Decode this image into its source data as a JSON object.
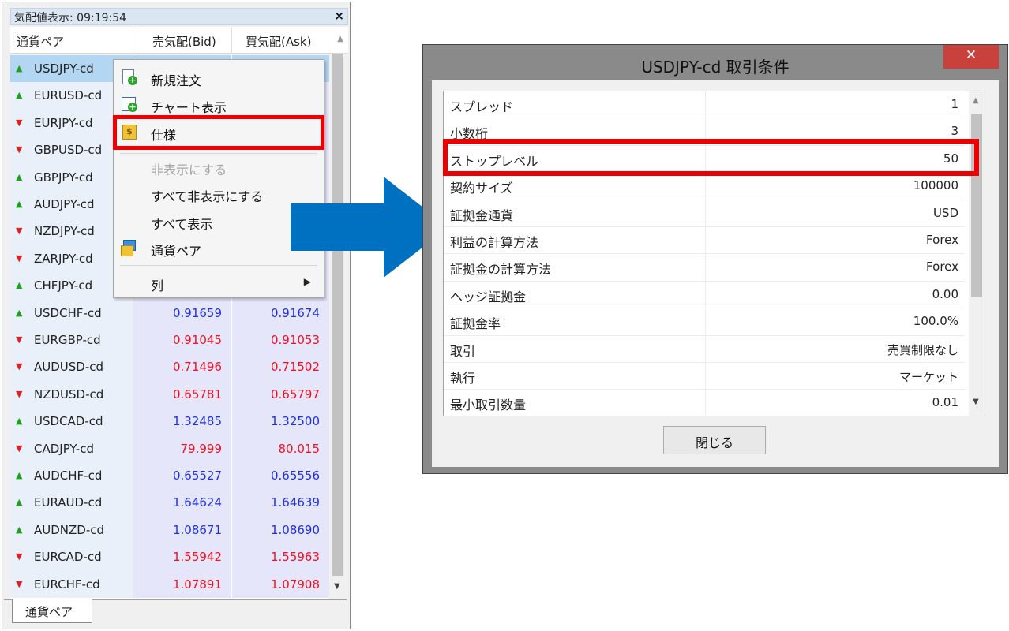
{
  "market_watch": {
    "title": "気配値表示: 09:19:54",
    "close_glyph": "×",
    "columns": {
      "symbol": "通貨ペア",
      "bid": "売気配(Bid)",
      "ask": "買気配(Ask)"
    },
    "rows": [
      {
        "symbol": "USDJPY-cd",
        "dir": "up",
        "bid": "",
        "ask": "",
        "color": "",
        "selected": true
      },
      {
        "symbol": "EURUSD-cd",
        "dir": "up",
        "bid": "",
        "ask": "",
        "color": ""
      },
      {
        "symbol": "EURJPY-cd",
        "dir": "down",
        "bid": "",
        "ask": "",
        "color": ""
      },
      {
        "symbol": "GBPUSD-cd",
        "dir": "down",
        "bid": "",
        "ask": "",
        "color": ""
      },
      {
        "symbol": "GBPJPY-cd",
        "dir": "up",
        "bid": "",
        "ask": "",
        "color": ""
      },
      {
        "symbol": "AUDJPY-cd",
        "dir": "up",
        "bid": "",
        "ask": "",
        "color": ""
      },
      {
        "symbol": "NZDJPY-cd",
        "dir": "down",
        "bid": "",
        "ask": "",
        "color": ""
      },
      {
        "symbol": "ZARJPY-cd",
        "dir": "down",
        "bid": "",
        "ask": "",
        "color": ""
      },
      {
        "symbol": "CHFJPY-cd",
        "dir": "up",
        "bid": "",
        "ask": "",
        "color": ""
      },
      {
        "symbol": "USDCHF-cd",
        "dir": "up",
        "bid": "0.91659",
        "ask": "0.91674",
        "color": "blue"
      },
      {
        "symbol": "EURGBP-cd",
        "dir": "down",
        "bid": "0.91045",
        "ask": "0.91053",
        "color": "red"
      },
      {
        "symbol": "AUDUSD-cd",
        "dir": "down",
        "bid": "0.71496",
        "ask": "0.71502",
        "color": "red"
      },
      {
        "symbol": "NZDUSD-cd",
        "dir": "down",
        "bid": "0.65781",
        "ask": "0.65797",
        "color": "red"
      },
      {
        "symbol": "USDCAD-cd",
        "dir": "up",
        "bid": "1.32485",
        "ask": "1.32500",
        "color": "blue"
      },
      {
        "symbol": "CADJPY-cd",
        "dir": "down",
        "bid": "79.999",
        "ask": "80.015",
        "color": "red"
      },
      {
        "symbol": "AUDCHF-cd",
        "dir": "up",
        "bid": "0.65527",
        "ask": "0.65556",
        "color": "blue"
      },
      {
        "symbol": "EURAUD-cd",
        "dir": "up",
        "bid": "1.64624",
        "ask": "1.64639",
        "color": "blue"
      },
      {
        "symbol": "AUDNZD-cd",
        "dir": "up",
        "bid": "1.08671",
        "ask": "1.08690",
        "color": "blue"
      },
      {
        "symbol": "EURCAD-cd",
        "dir": "down",
        "bid": "1.55942",
        "ask": "1.55963",
        "color": "red"
      },
      {
        "symbol": "EURCHF-cd",
        "dir": "down",
        "bid": "1.07891",
        "ask": "1.07908",
        "color": "red"
      }
    ],
    "tab_label": "通貨ペア",
    "colors": {
      "up": "#1fa01f",
      "down": "#e02020",
      "bid_blue": "#2030e0",
      "bid_red": "#f01020"
    }
  },
  "context_menu": {
    "items": [
      {
        "label": "新規注文",
        "icon": "new-order-icon"
      },
      {
        "label": "チャート表示",
        "icon": "chart-icon"
      },
      {
        "label": "仕様",
        "icon": "specification-icon",
        "highlighted": true
      },
      {
        "label": "非表示にする",
        "icon": "",
        "disabled": true
      },
      {
        "label": "すべて非表示にする",
        "icon": ""
      },
      {
        "label": "すべて表示",
        "icon": ""
      },
      {
        "label": "通貨ペア",
        "icon": "currency-pair-icon"
      },
      {
        "label": "列",
        "icon": "",
        "submenu": true
      }
    ],
    "submenu_glyph": "▶"
  },
  "dialog": {
    "title": "USDJPY-cd 取引条件",
    "close_glyph": "✕",
    "rows": [
      {
        "name": "スプレッド",
        "value": "1"
      },
      {
        "name": "小数桁",
        "value": "3"
      },
      {
        "name": "ストップレベル",
        "value": "50",
        "highlighted": true
      },
      {
        "name": "契約サイズ",
        "value": "100000"
      },
      {
        "name": "証拠金通貨",
        "value": "USD"
      },
      {
        "name": "利益の計算方法",
        "value": "Forex"
      },
      {
        "name": "証拠金の計算方法",
        "value": "Forex"
      },
      {
        "name": "ヘッジ証拠金",
        "value": "0.00"
      },
      {
        "name": "証拠金率",
        "value": "100.0%"
      },
      {
        "name": "取引",
        "value": "売買制限なし"
      },
      {
        "name": "執行",
        "value": "マーケット"
      },
      {
        "name": "最小取引数量",
        "value": "0.01"
      }
    ],
    "close_button": "閉じる"
  },
  "colors": {
    "highlight": "#ee0000",
    "arrow_blue": "#0070c0",
    "dialog_close": "#c8413d"
  }
}
